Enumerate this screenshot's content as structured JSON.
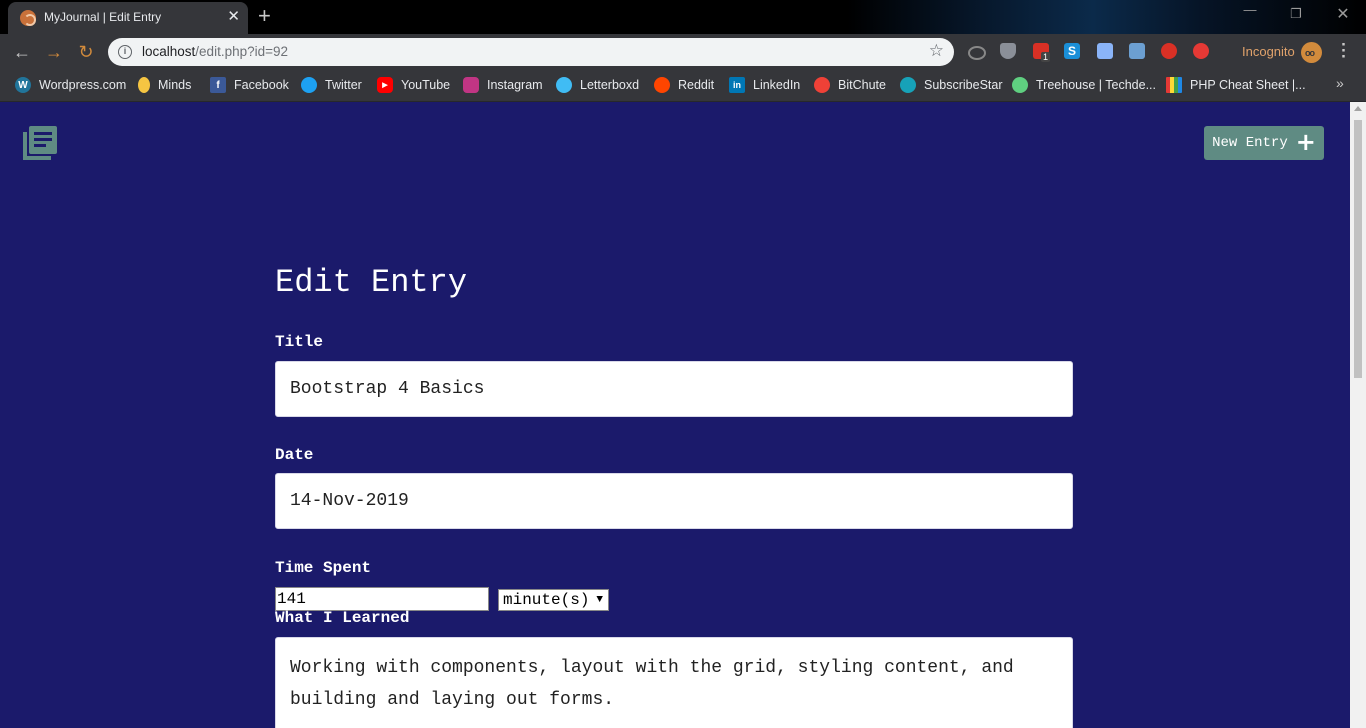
{
  "browser": {
    "tab_title": "MyJournal | Edit Entry",
    "url_host": "localhost",
    "url_path": "/edit.php?id=92",
    "incognito_label": "Incognito",
    "extension_badge": "1",
    "bookmarks": [
      {
        "label": "Wordpress.com",
        "icon": "wordpress-icon",
        "color": "#21759b"
      },
      {
        "label": "Minds",
        "icon": "bulb-icon",
        "color": "#f5c542"
      },
      {
        "label": "Facebook",
        "icon": "facebook-icon",
        "color": "#3b5998"
      },
      {
        "label": "Twitter",
        "icon": "twitter-icon",
        "color": "#1da1f2"
      },
      {
        "label": "YouTube",
        "icon": "youtube-icon",
        "color": "#ff0000"
      },
      {
        "label": "Instagram",
        "icon": "instagram-icon",
        "color": "#c13584"
      },
      {
        "label": "Letterboxd",
        "icon": "letterboxd-icon",
        "color": "#40bcf4"
      },
      {
        "label": "Reddit",
        "icon": "reddit-icon",
        "color": "#ff4500"
      },
      {
        "label": "LinkedIn",
        "icon": "linkedin-icon",
        "color": "#0077b5"
      },
      {
        "label": "BitChute",
        "icon": "bitchute-icon",
        "color": "#ef4137"
      },
      {
        "label": "SubscribeStar",
        "icon": "subscribestar-icon",
        "color": "#17a2b8"
      },
      {
        "label": "Treehouse | Techde...",
        "icon": "treehouse-icon",
        "color": "#5fcf80"
      },
      {
        "label": "PHP Cheat Sheet |...",
        "icon": "php-icon",
        "color": "#8892bf"
      }
    ]
  },
  "header": {
    "logo_icon": "journal-icon",
    "new_entry_label": "New Entry",
    "new_entry_icon": "plus-icon"
  },
  "form": {
    "heading": "Edit Entry",
    "title_label": "Title",
    "title_value": "Bootstrap 4 Basics",
    "date_label": "Date",
    "date_value": "14-Nov-2019",
    "time_label": "Time Spent",
    "time_value": "141",
    "time_unit": "minute(s)",
    "learned_label": "What I Learned",
    "learned_value": "Working with components, layout with the grid, styling content, and building and laying out forms."
  },
  "colors": {
    "page_bg": "#1b1a6b",
    "button_bg": "#5f8b83",
    "accent": "#d28b3c"
  }
}
